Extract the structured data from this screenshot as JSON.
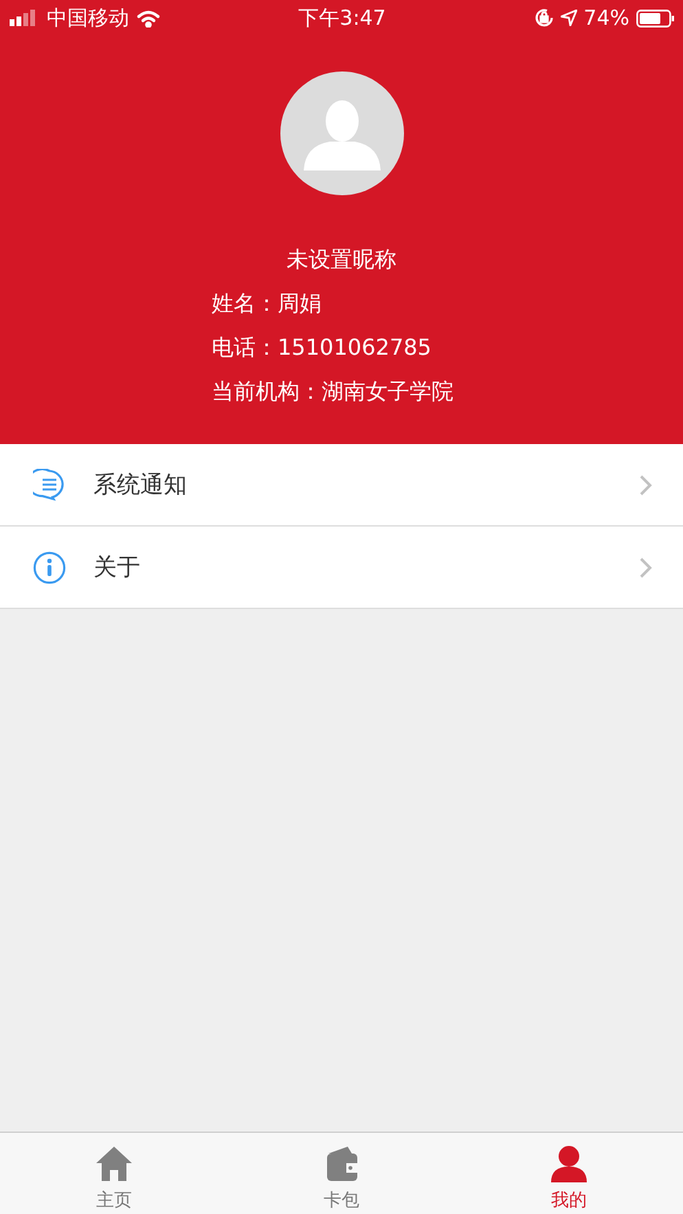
{
  "status_bar": {
    "carrier": "中国移动",
    "time": "下午3:47",
    "battery": "74%"
  },
  "profile": {
    "nickname": "未设置昵称",
    "fields": [
      {
        "label": "姓名：",
        "value": "周娟"
      },
      {
        "label": "电话：",
        "value": "15101062785"
      },
      {
        "label": "当前机构：",
        "value": "湖南女子学院"
      }
    ]
  },
  "menu": [
    {
      "kind": "chat",
      "label": "系统通知"
    },
    {
      "kind": "info",
      "label": "关于"
    }
  ],
  "tab_bar": [
    {
      "kind": "home",
      "label": "主页",
      "selected": false
    },
    {
      "kind": "wallet",
      "label": "卡包",
      "selected": false
    },
    {
      "kind": "person",
      "label": "我的",
      "selected": true
    }
  ]
}
